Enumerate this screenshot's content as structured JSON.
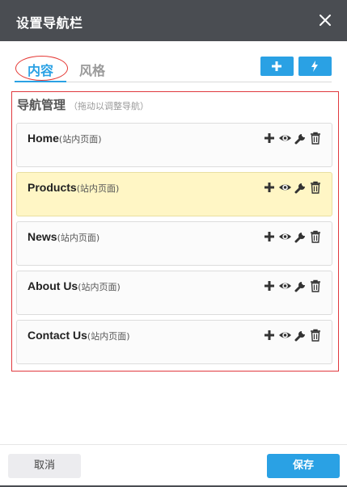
{
  "dialog": {
    "title": "设置导航栏"
  },
  "tabs": [
    {
      "label": "内容",
      "active": true
    },
    {
      "label": "风格",
      "active": false
    }
  ],
  "toolbar": {
    "add_icon": "plus-icon",
    "quick_icon": "lightning-icon"
  },
  "section": {
    "title": "导航管理",
    "hint": "（拖动以调整导航）"
  },
  "nav_items": [
    {
      "name": "Home",
      "type": "(站内页面)",
      "highlighted": false
    },
    {
      "name": "Products",
      "type": "(站内页面)",
      "highlighted": true
    },
    {
      "name": "News",
      "type": "(站内页面)",
      "highlighted": false
    },
    {
      "name": "About Us",
      "type": "(站内页面)",
      "highlighted": false
    },
    {
      "name": "Contact Us",
      "type": "(站内页面)",
      "highlighted": false
    }
  ],
  "item_action_icons": [
    "plus-icon",
    "eye-icon",
    "wrench-icon",
    "trash-icon"
  ],
  "footer": {
    "cancel_label": "取消",
    "save_label": "保存"
  },
  "colors": {
    "accent": "#2aa1e4",
    "titlebar": "#4a4d52",
    "highlight": "#fff6c5",
    "annotation": "#e0393e"
  }
}
